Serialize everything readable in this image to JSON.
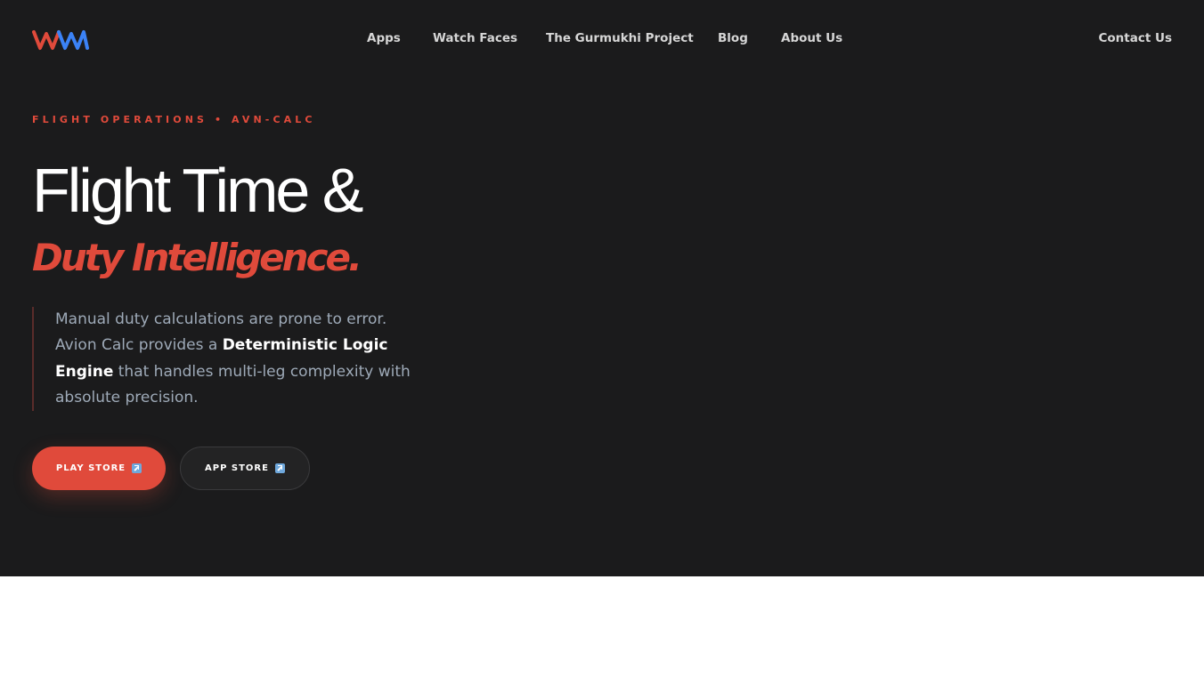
{
  "brand": {
    "logo_text": "VVM",
    "logo_colors": [
      "#e04a3b",
      "#3b82f6"
    ]
  },
  "nav": {
    "items": [
      "Apps",
      "Watch Faces",
      "The Gurmukhi Project",
      "Blog",
      "About Us"
    ],
    "contact": "Contact Us"
  },
  "hero": {
    "eyebrow": "FLIGHT OPERATIONS • AVN-CALC",
    "title_line1": "Flight Time &",
    "title_line2": "Duty Intelligence.",
    "desc": {
      "part1": "Manual duty calculations are prone to error. Avion Calc provides a ",
      "bold": "Deterministic Logic Engine",
      "part2": " that handles multi-leg complexity with absolute precision."
    },
    "buttons": {
      "play": "PLAY STORE",
      "app": "APP STORE"
    }
  },
  "colors": {
    "accent": "#e04a3b",
    "background": "#1b1b1c",
    "muted_text": "#9eaab8"
  }
}
